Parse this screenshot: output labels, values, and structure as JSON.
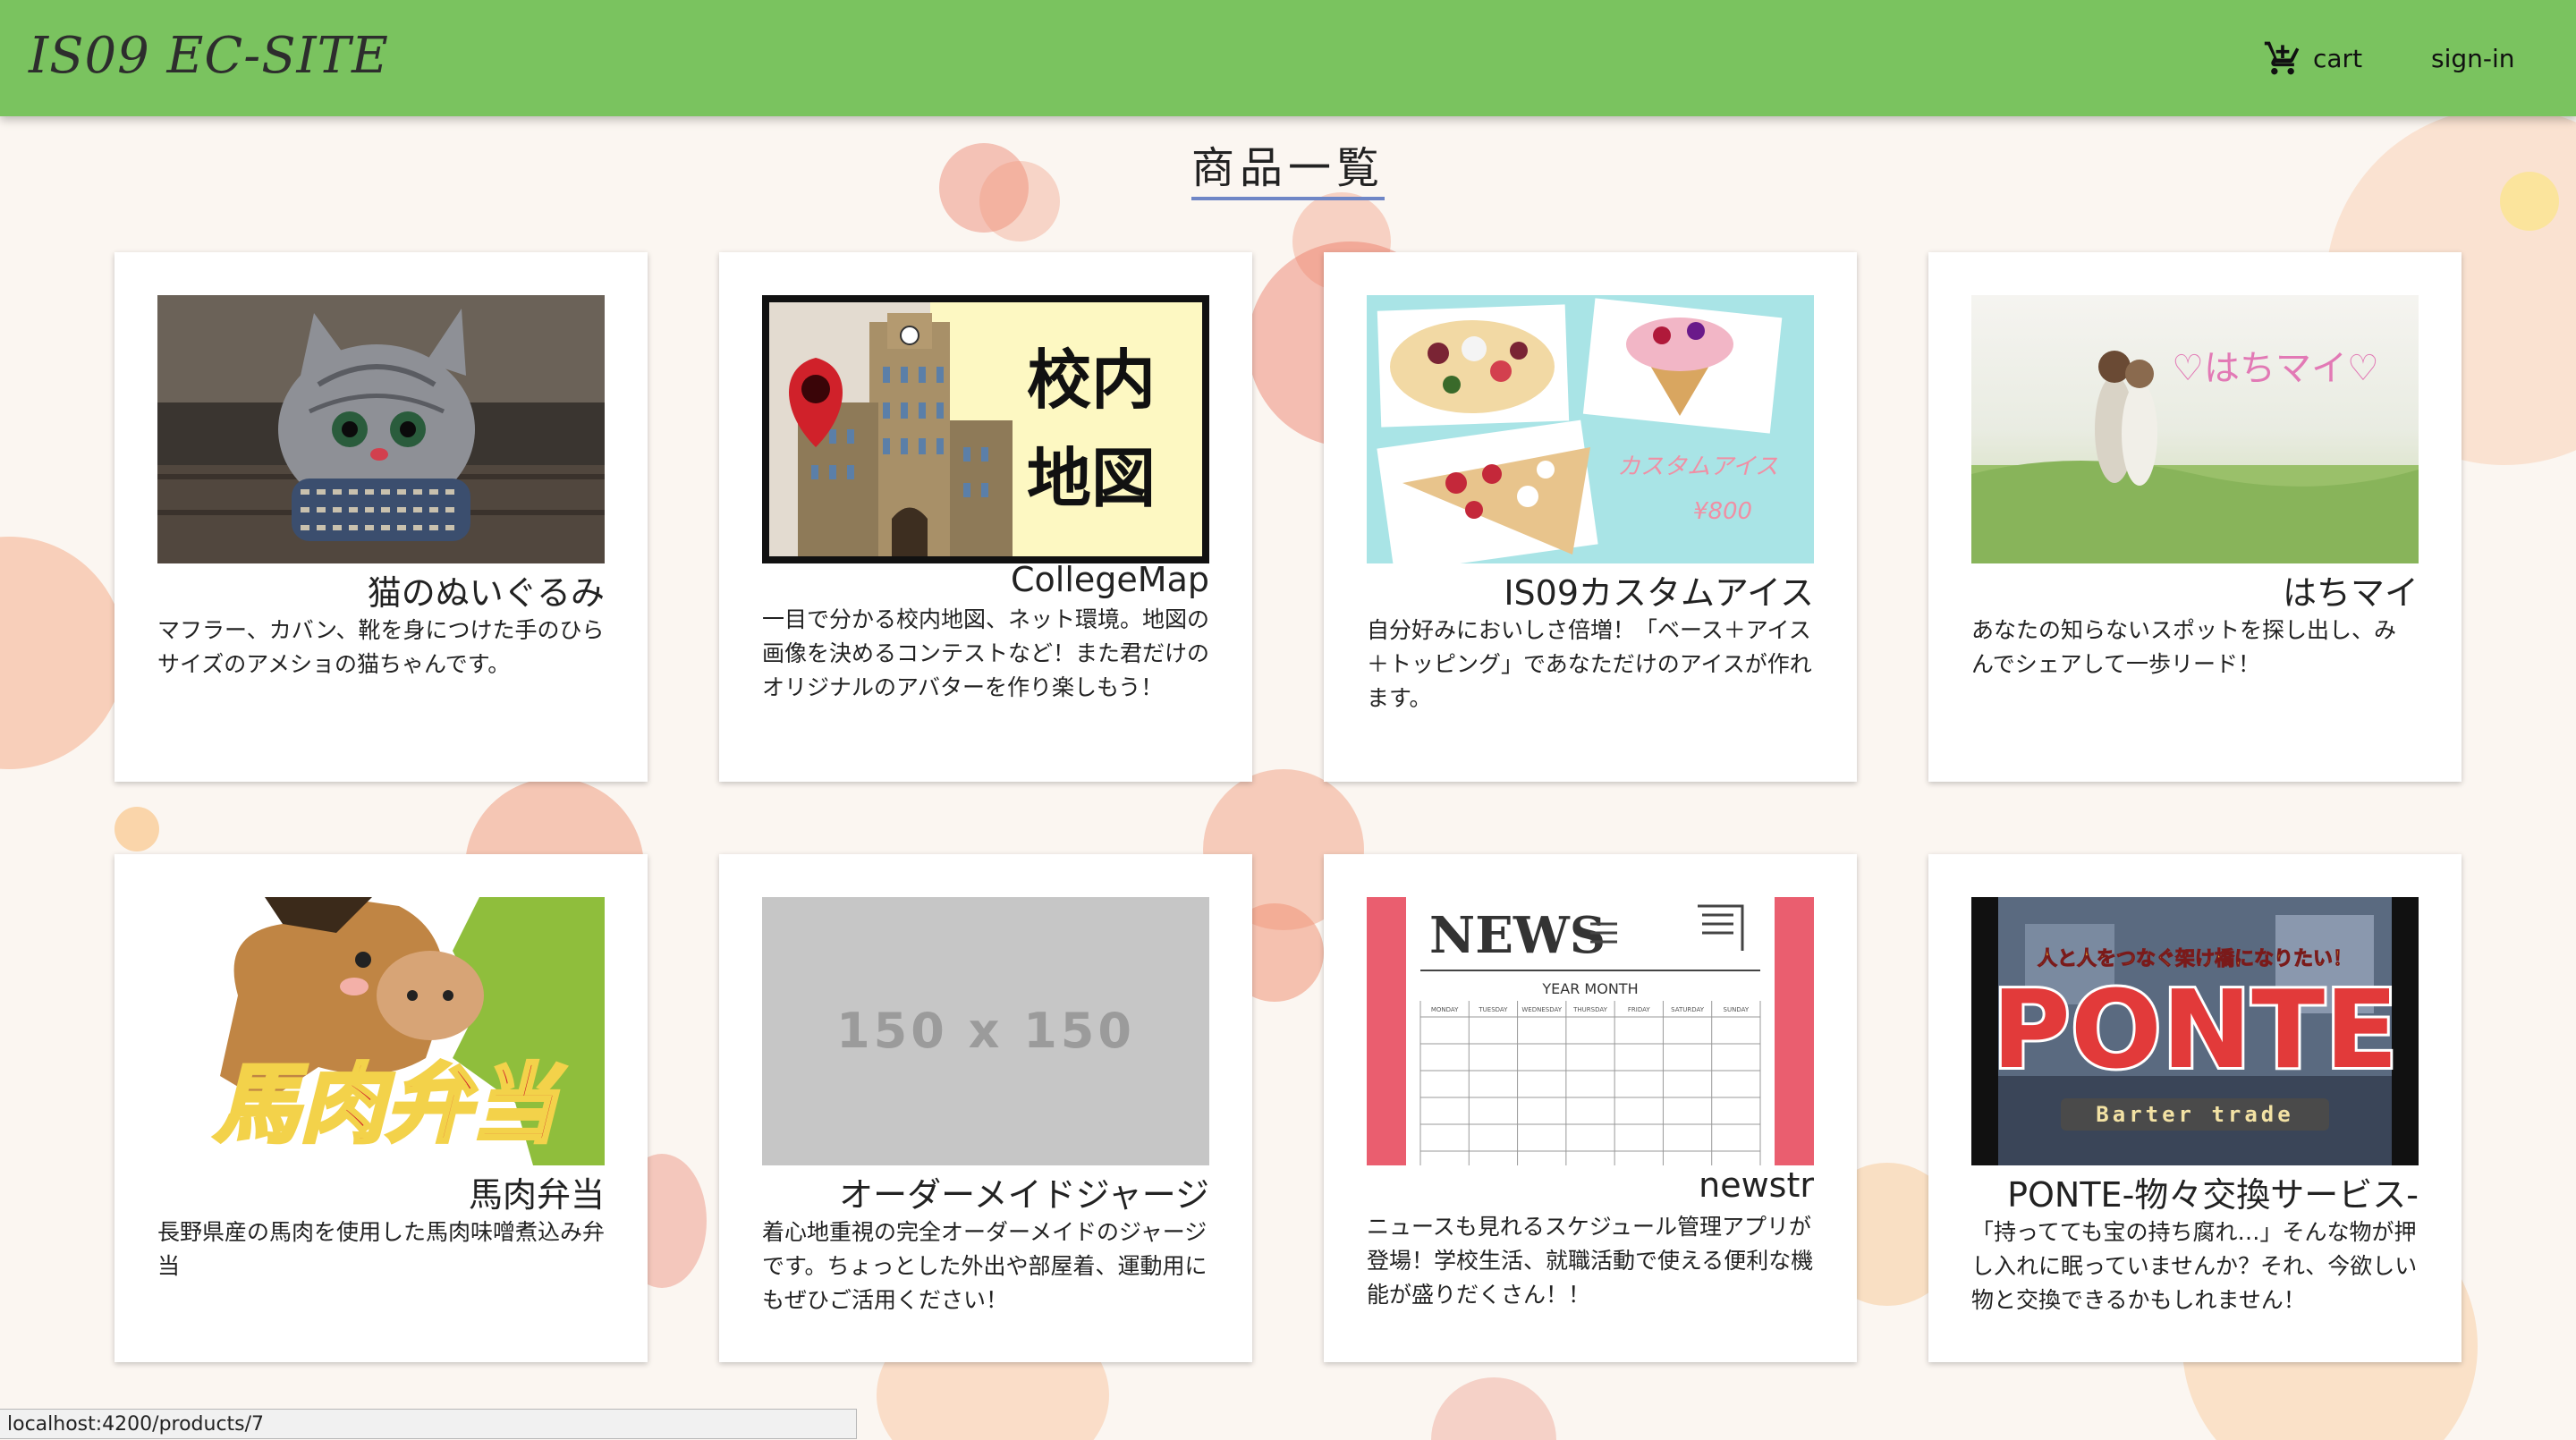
{
  "header": {
    "brand": "IS09 EC-SITE",
    "cart_label": "cart",
    "signin_label": "sign-in",
    "bar_color": "#7ac35f"
  },
  "page": {
    "title": "商品一覧"
  },
  "products": [
    {
      "name": "猫のぬいぐるみ",
      "description": "マフラー、カバン、靴を身につけた手のひらサイズのアメショの猫ちゃんです。",
      "image": "cat-plush-photo"
    },
    {
      "name": "CollegeMap",
      "description": "一目で分かる校内地図、ネット環境。地図の画像を決めるコンテストなど！また君だけのオリジナルのアバターを作り楽しもう！",
      "image": "campus-map-illustration",
      "image_text_1": "校内",
      "image_text_2": "地図"
    },
    {
      "name": "IS09カスタムアイス",
      "description": "自分好みにおいしさ倍増！「ベース＋アイス＋トッピング」であなただけのアイスが作れます。",
      "image": "custom-ice-photo",
      "image_text_1": "カスタムアイス",
      "image_text_2": "¥800"
    },
    {
      "name": "はちマイ",
      "description": "あなたの知らないスポットを探し出し、みんでシェアして一歩リード！",
      "image": "couple-in-field-photo",
      "image_text_1": "♡はちマイ♡"
    },
    {
      "name": "馬肉弁当",
      "description": "長野県産の馬肉を使用した馬肉味噌煮込み弁当",
      "image": "horse-illustration",
      "image_text_1": "馬肉弁当"
    },
    {
      "name": "オーダーメイドジャージ",
      "description": "着心地重視の完全オーダーメイドのジャージです。ちょっとした外出や部屋着、運動用にもぜひご活用ください！",
      "image": "placeholder-image",
      "image_text_1": "150 x 150"
    },
    {
      "name": "newstr",
      "description": "ニュースも見れるスケジュール管理アプリが登場！学校生活、就職活動で使える便利な機能が盛りだくさん！！",
      "image": "news-calendar-illustration",
      "image_text_1": "NEWS",
      "image_text_2": "YEAR  MONTH",
      "weekdays": [
        "MONDAY",
        "TUESDAY",
        "WEDNESDAY",
        "THURSDAY",
        "FRIDAY",
        "SATURDAY",
        "SUNDAY"
      ]
    },
    {
      "name": "PONTE-物々交換サービス-",
      "description": "「持ってても宝の持ち腐れ…」そんな物が押し入れに眠っていませんか？それ、今欲しい物と交換できるかもしれません！",
      "image": "ponte-logo-photo",
      "image_text_1": "人と人をつなぐ架け橋になりたい！",
      "image_text_2": "PONTE",
      "image_text_3": "Barter trade"
    }
  ],
  "status_bar": {
    "url": "localhost:4200/products/7"
  }
}
